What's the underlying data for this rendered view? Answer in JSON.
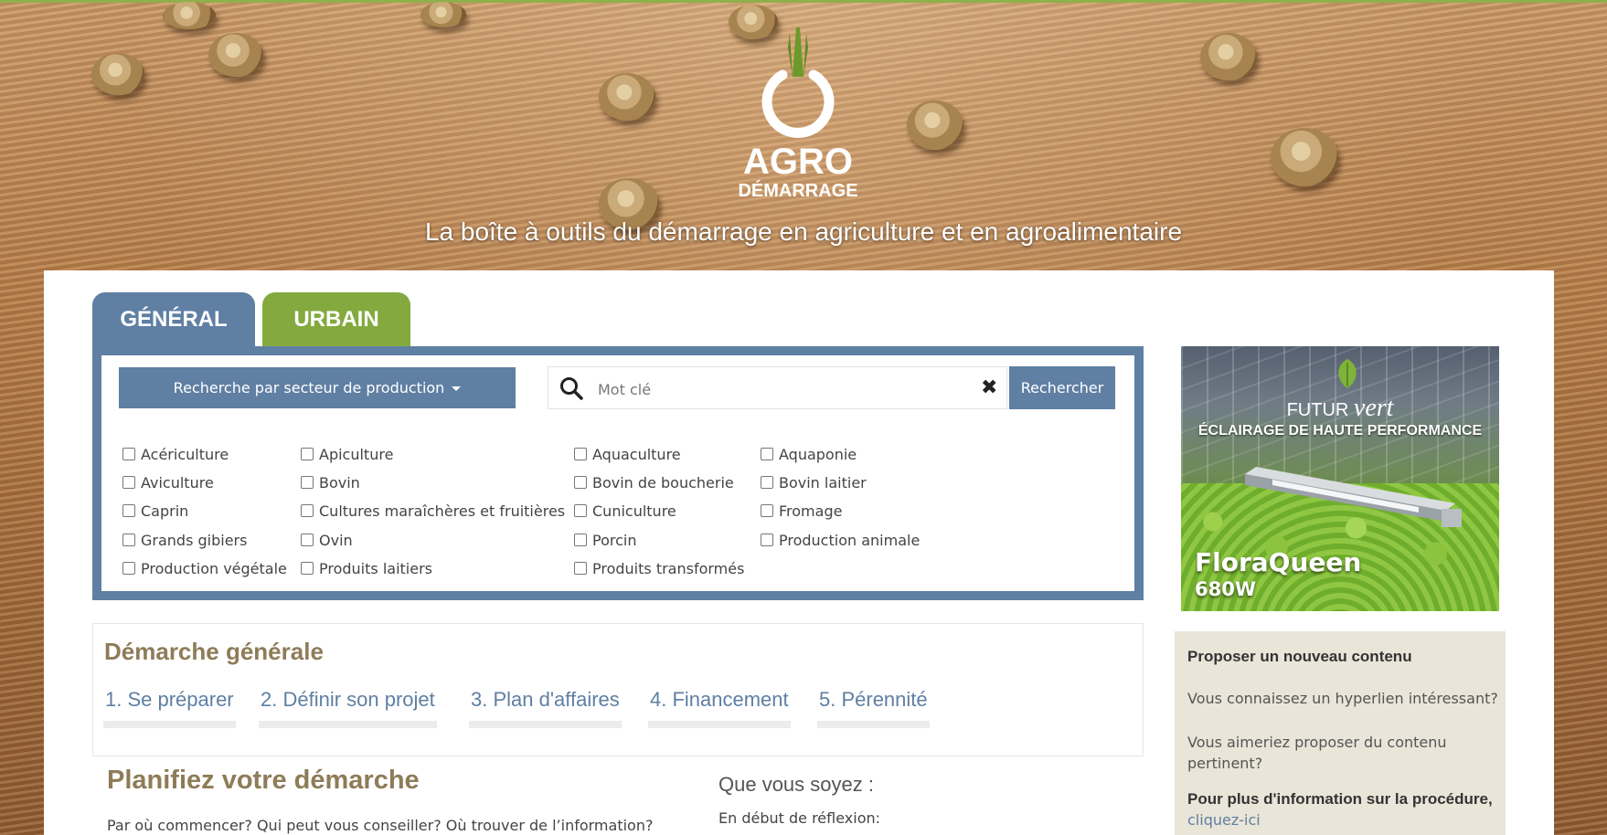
{
  "header": {
    "logo_line1": "AGRO",
    "logo_line2": "DÉMARRAGE",
    "tagline": "La boîte à outils du démarrage en agriculture et en agroalimentaire"
  },
  "tabs": [
    {
      "label": "GÉNÉRAL",
      "active": true,
      "color": "#5f7fa3"
    },
    {
      "label": "URBAIN",
      "active": false,
      "color": "#84aa3f"
    }
  ],
  "search": {
    "sector_button": "Recherche par secteur de production",
    "placeholder": "Mot clé",
    "value": "",
    "submit_label": "Rechercher"
  },
  "sectors": [
    [
      "Acériculture",
      "Apiculture",
      "Aquaculture",
      "Aquaponie"
    ],
    [
      "Aviculture",
      "Bovin",
      "Bovin de boucherie",
      "Bovin laitier"
    ],
    [
      "Caprin",
      "Cultures maraîchères et fruitières",
      "Cuniculture",
      "Fromage"
    ],
    [
      "Grands gibiers",
      "Ovin",
      "Porcin",
      "Production animale"
    ],
    [
      "Production végétale",
      "Produits laitiers",
      "Produits transformés"
    ]
  ],
  "demarche": {
    "title": "Démarche générale",
    "steps": [
      "1. Se préparer",
      "2. Définir son projet",
      "3. Plan d'affaires",
      "4. Financement",
      "5. Pérennité"
    ]
  },
  "plan": {
    "title": "Planifiez votre démarche",
    "text": "Par où commencer? Qui peut vous conseiller? Où trouver de l’information?"
  },
  "que": {
    "title": "Que vous soyez :",
    "text": "En début de réflexion:"
  },
  "ad": {
    "brand_1": "FUTUR",
    "brand_2": "vert",
    "headline": "ÉCLAIRAGE DE HAUTE PERFORMANCE",
    "product": "FloraQueen",
    "power": "680W"
  },
  "propose": {
    "title": "Proposer un nouveau contenu",
    "q1": "Vous connaissez un hyperlien intéressant?",
    "q2": "Vous aimeriez proposer du contenu pertinent?",
    "info": "Pour plus d'information sur la procédure,",
    "link": "cliquez-ici"
  },
  "colors": {
    "primary_blue": "#5f7fa3",
    "urbain_green": "#84aa3f",
    "heading_tan": "#8e7c58",
    "sidebar_bg": "#e9e5d8"
  }
}
